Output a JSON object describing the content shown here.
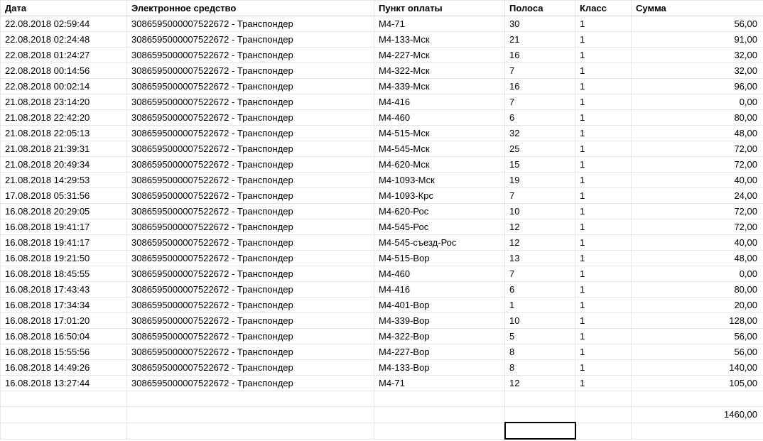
{
  "headers": {
    "date": "Дата",
    "device": "Электронное средство",
    "point": "Пункт оплаты",
    "lane": "Полоса",
    "class": "Класс",
    "sum": "Сумма"
  },
  "rows": [
    {
      "date": "22.08.2018 02:59:44",
      "device": "3086595000007522672 - Транспондер",
      "point": "M4-71",
      "lane": "30",
      "class": "1",
      "sum": "56,00"
    },
    {
      "date": "22.08.2018 02:24:48",
      "device": "3086595000007522672 - Транспондер",
      "point": "M4-133-Мск",
      "lane": "21",
      "class": "1",
      "sum": "91,00"
    },
    {
      "date": "22.08.2018 01:24:27",
      "device": "3086595000007522672 - Транспондер",
      "point": "M4-227-Мск",
      "lane": "16",
      "class": "1",
      "sum": "32,00"
    },
    {
      "date": "22.08.2018 00:14:56",
      "device": "3086595000007522672 - Транспондер",
      "point": "M4-322-Мск",
      "lane": "7",
      "class": "1",
      "sum": "32,00"
    },
    {
      "date": "22.08.2018 00:02:14",
      "device": "3086595000007522672 - Транспондер",
      "point": "M4-339-Мск",
      "lane": "16",
      "class": "1",
      "sum": "96,00"
    },
    {
      "date": "21.08.2018 23:14:20",
      "device": "3086595000007522672 - Транспондер",
      "point": "M4-416",
      "lane": "7",
      "class": "1",
      "sum": "0,00"
    },
    {
      "date": "21.08.2018 22:42:20",
      "device": "3086595000007522672 - Транспондер",
      "point": "M4-460",
      "lane": "6",
      "class": "1",
      "sum": "80,00"
    },
    {
      "date": "21.08.2018 22:05:13",
      "device": "3086595000007522672 - Транспондер",
      "point": "M4-515-Мск",
      "lane": "32",
      "class": "1",
      "sum": "48,00"
    },
    {
      "date": "21.08.2018 21:39:31",
      "device": "3086595000007522672 - Транспондер",
      "point": "M4-545-Мск",
      "lane": "25",
      "class": "1",
      "sum": "72,00"
    },
    {
      "date": "21.08.2018 20:49:34",
      "device": "3086595000007522672 - Транспондер",
      "point": "M4-620-Мск",
      "lane": "15",
      "class": "1",
      "sum": "72,00"
    },
    {
      "date": "21.08.2018 14:29:53",
      "device": "3086595000007522672 - Транспондер",
      "point": "M4-1093-Мск",
      "lane": "19",
      "class": "1",
      "sum": "40,00"
    },
    {
      "date": "17.08.2018 05:31:56",
      "device": "3086595000007522672 - Транспондер",
      "point": "M4-1093-Крс",
      "lane": "7",
      "class": "1",
      "sum": "24,00"
    },
    {
      "date": "16.08.2018 20:29:05",
      "device": "3086595000007522672 - Транспондер",
      "point": "M4-620-Рос",
      "lane": "10",
      "class": "1",
      "sum": "72,00"
    },
    {
      "date": "16.08.2018 19:41:17",
      "device": "3086595000007522672 - Транспондер",
      "point": "M4-545-Рос",
      "lane": "12",
      "class": "1",
      "sum": "72,00"
    },
    {
      "date": "16.08.2018 19:41:17",
      "device": "3086595000007522672 - Транспондер",
      "point": "M4-545-съезд-Рос",
      "lane": "12",
      "class": "1",
      "sum": "40,00"
    },
    {
      "date": "16.08.2018 19:21:50",
      "device": "3086595000007522672 - Транспондер",
      "point": "M4-515-Вор",
      "lane": "13",
      "class": "1",
      "sum": "48,00"
    },
    {
      "date": "16.08.2018 18:45:55",
      "device": "3086595000007522672 - Транспондер",
      "point": "M4-460",
      "lane": "7",
      "class": "1",
      "sum": "0,00"
    },
    {
      "date": "16.08.2018 17:43:43",
      "device": "3086595000007522672 - Транспондер",
      "point": "M4-416",
      "lane": "6",
      "class": "1",
      "sum": "80,00"
    },
    {
      "date": "16.08.2018 17:34:34",
      "device": "3086595000007522672 - Транспондер",
      "point": "M4-401-Вор",
      "lane": "1",
      "class": "1",
      "sum": "20,00"
    },
    {
      "date": "16.08.2018 17:01:20",
      "device": "3086595000007522672 - Транспондер",
      "point": "M4-339-Вор",
      "lane": "10",
      "class": "1",
      "sum": "128,00"
    },
    {
      "date": "16.08.2018 16:50:04",
      "device": "3086595000007522672 - Транспондер",
      "point": "M4-322-Вор",
      "lane": "5",
      "class": "1",
      "sum": "56,00"
    },
    {
      "date": "16.08.2018 15:55:56",
      "device": "3086595000007522672 - Транспондер",
      "point": "M4-227-Вор",
      "lane": "8",
      "class": "1",
      "sum": "56,00"
    },
    {
      "date": "16.08.2018 14:49:26",
      "device": "3086595000007522672 - Транспондер",
      "point": "M4-133-Вор",
      "lane": "8",
      "class": "1",
      "sum": "140,00"
    },
    {
      "date": "16.08.2018 13:27:44",
      "device": "3086595000007522672 - Транспондер",
      "point": "M4-71",
      "lane": "12",
      "class": "1",
      "sum": "105,00"
    }
  ],
  "total": "1460,00"
}
